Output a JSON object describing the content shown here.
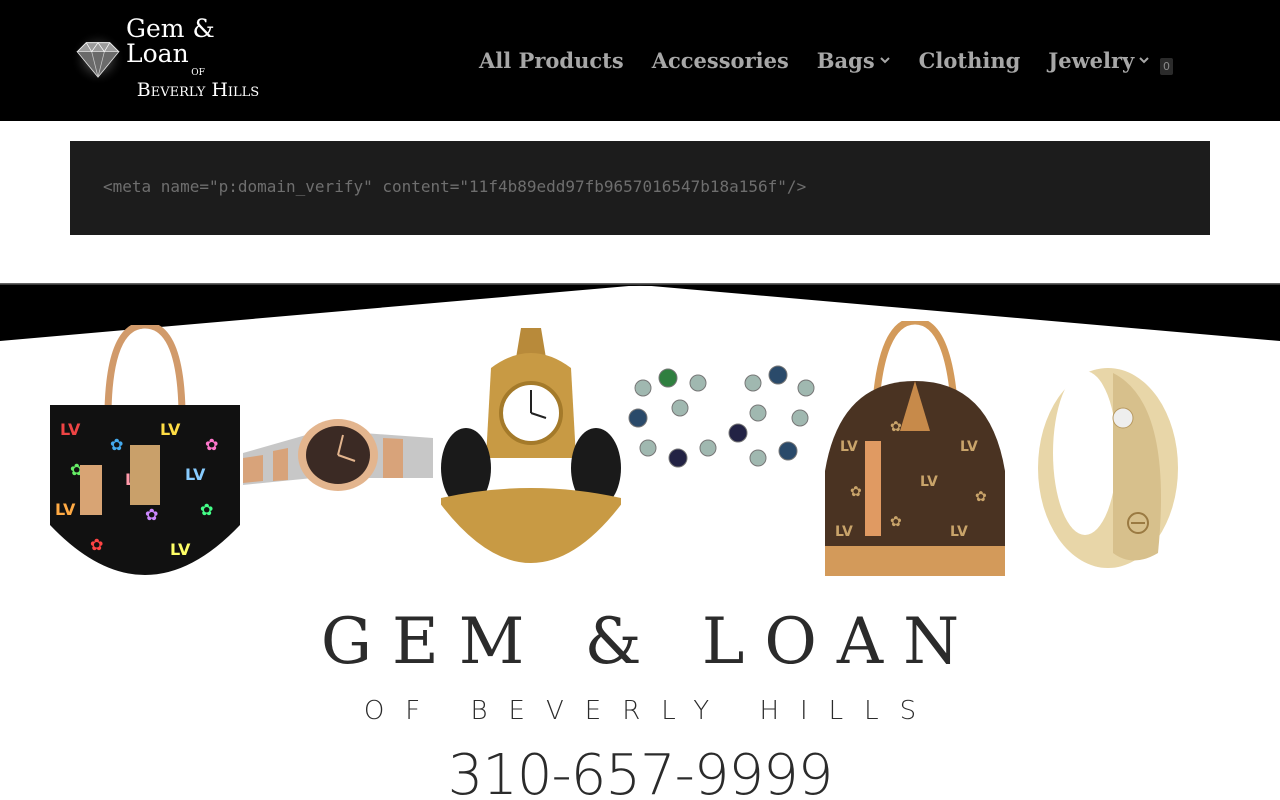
{
  "header": {
    "logo": {
      "line1": "Gem & Loan",
      "line2": "OF",
      "line3": "Beverly Hills"
    },
    "nav": [
      {
        "label": "All Products",
        "has_dropdown": false
      },
      {
        "label": "Accessories",
        "has_dropdown": false
      },
      {
        "label": "Bags",
        "has_dropdown": true
      },
      {
        "label": "Clothing",
        "has_dropdown": false
      },
      {
        "label": "Jewelry",
        "has_dropdown": true
      }
    ],
    "cart_count": "0"
  },
  "code_block": {
    "text": "<meta name=\"p:domain_verify\" content=\"11f4b89edd97fb9657016547b18a156f\"/>"
  },
  "banner": {
    "title": "GEM & LOAN",
    "subtitle": "OF BEVERLY HILLS",
    "phone": "310-657-9999",
    "products": [
      "handbag-multicolor-icon",
      "watch-icon",
      "clock-icon",
      "earrings-icon",
      "handbag-brown-icon",
      "ring-icon"
    ]
  },
  "colors": {
    "header_bg": "#000000",
    "nav_text": "#a7a7a7",
    "code_bg": "#1c1c1c",
    "code_text": "#6e6e6e",
    "brand_text": "#2b2b2b"
  }
}
